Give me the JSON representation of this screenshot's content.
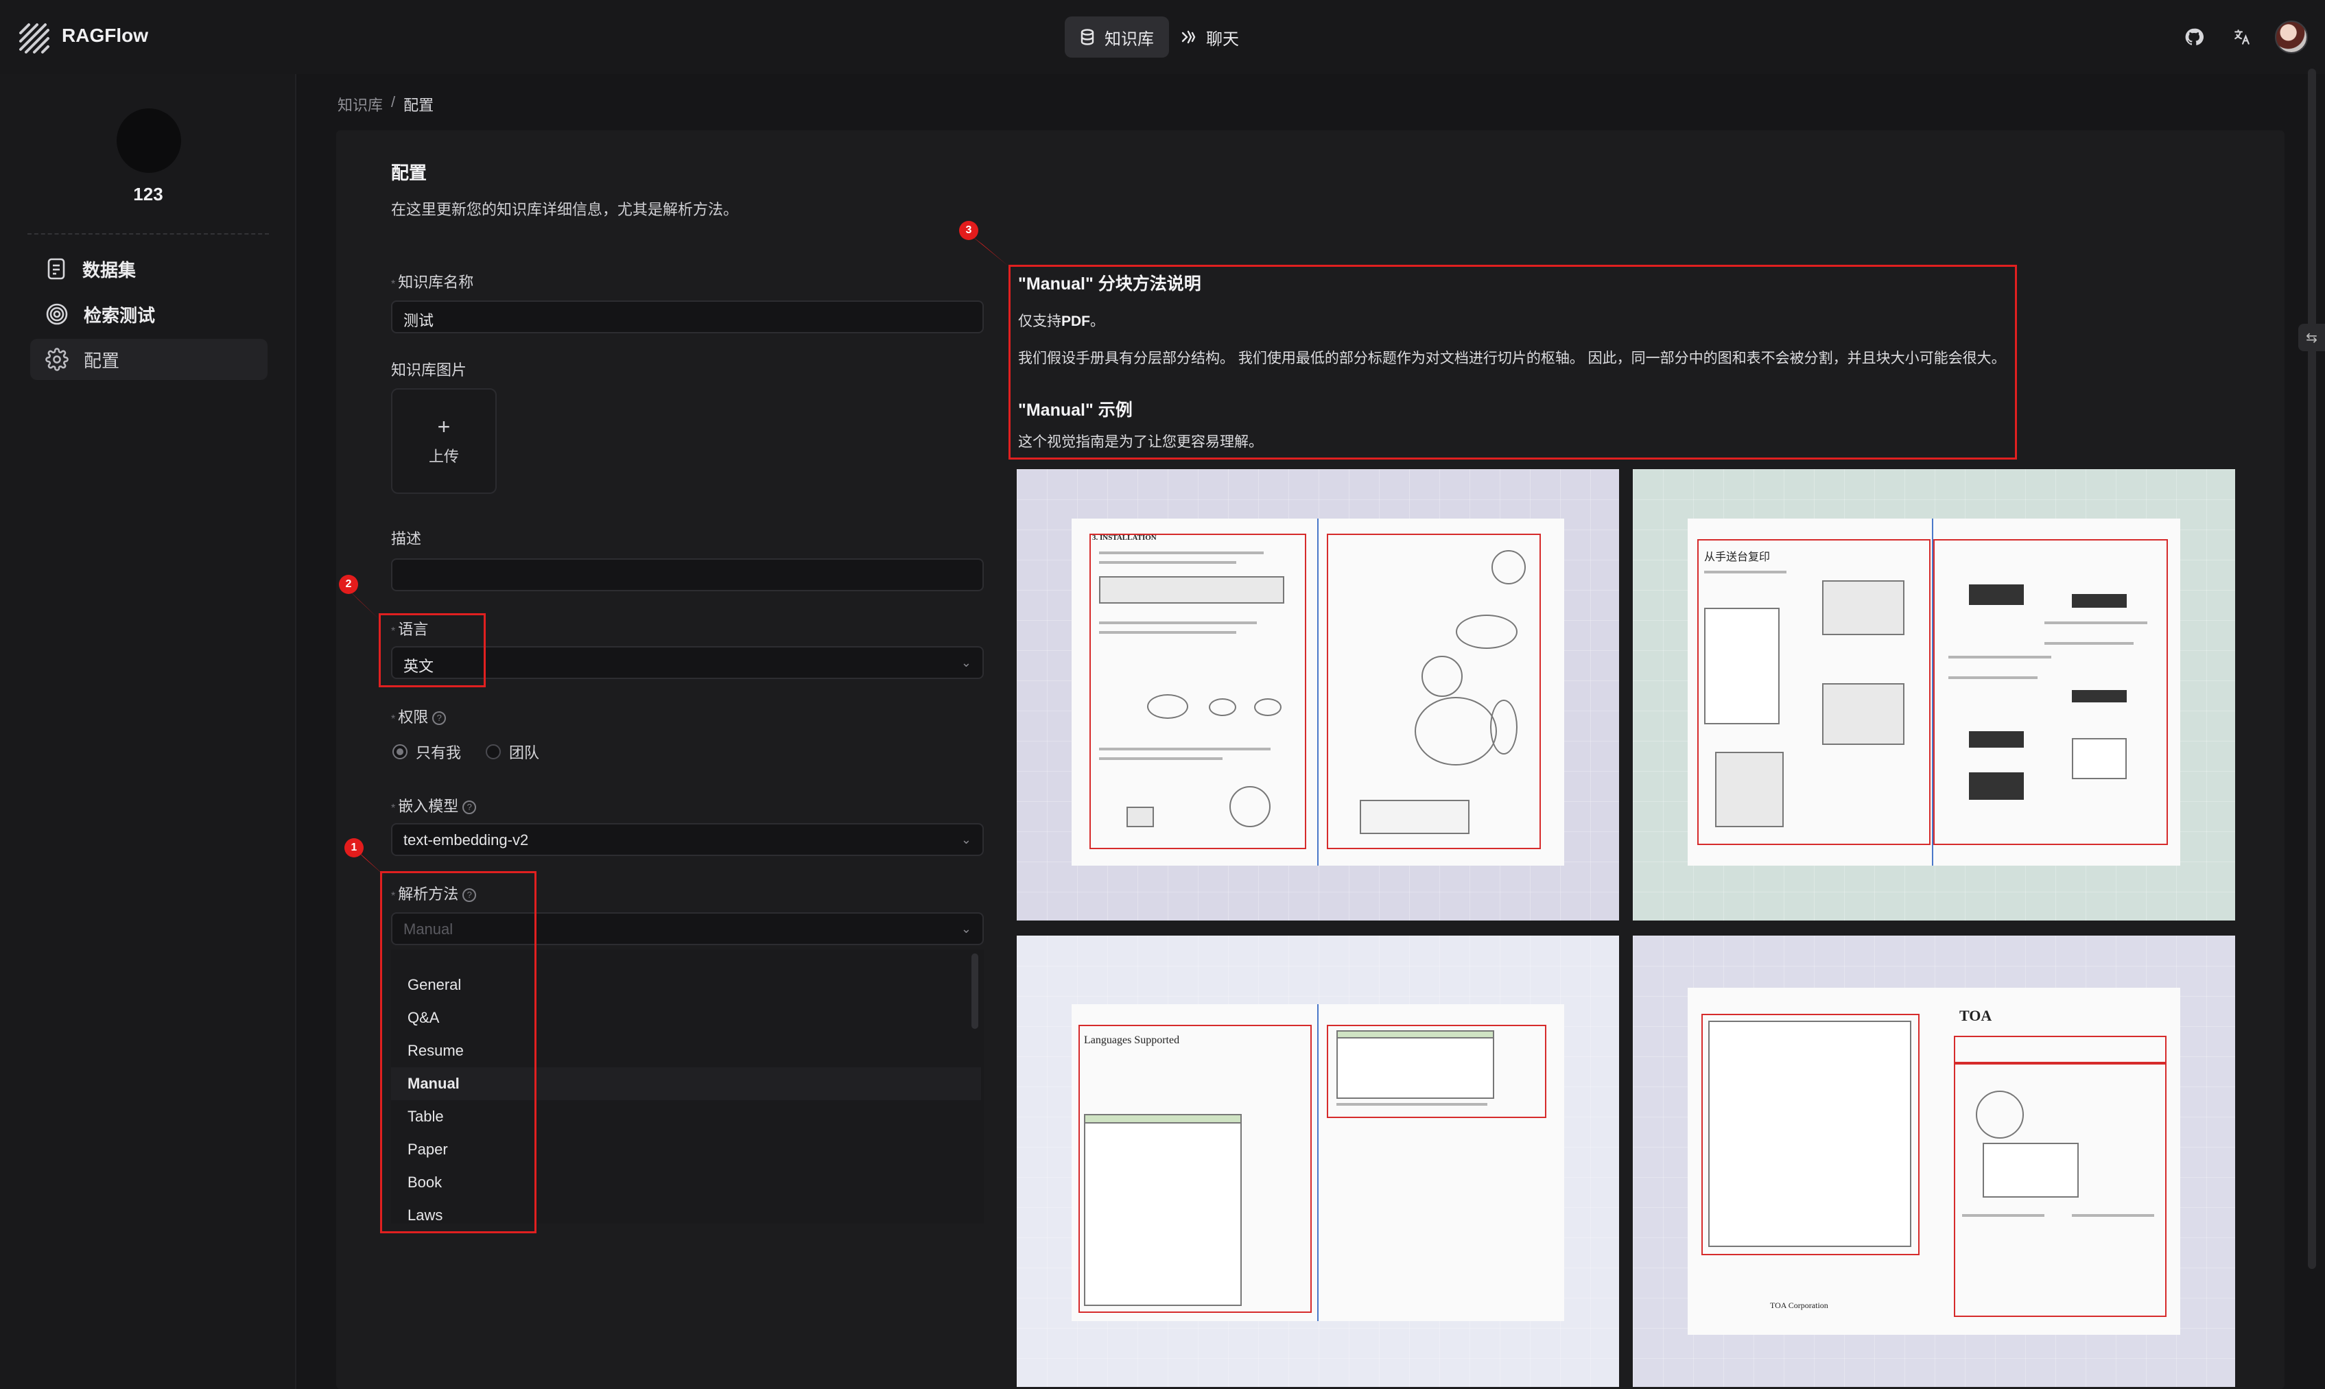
{
  "app": {
    "brand": "RAGFlow"
  },
  "topnav": [
    {
      "label": "知识库",
      "icon": "database-icon"
    },
    {
      "label": "聊天",
      "icon": "chat-icon"
    }
  ],
  "sidebar": {
    "kb_name": "123",
    "items": [
      {
        "label": "数据集",
        "icon": "document-icon"
      },
      {
        "label": "检索测试",
        "icon": "target-icon"
      },
      {
        "label": "配置",
        "icon": "gear-icon"
      }
    ]
  },
  "breadcrumb": {
    "root": "知识库",
    "separator": "/",
    "current": "配置"
  },
  "config": {
    "title": "配置",
    "subtitle": "在这里更新您的知识库详细信息，尤其是解析方法。",
    "name_label": "知识库名称",
    "name_value": "测试",
    "image_label": "知识库图片",
    "upload_label": "上传",
    "upload_plus": "+",
    "desc_label": "描述",
    "desc_value": "",
    "language_label": "语言",
    "language_value": "英文",
    "permission_label": "权限",
    "permission_options": [
      "只有我",
      "团队"
    ],
    "permission_selected": "只有我",
    "embedding_label": "嵌入模型",
    "embedding_value": "text-embedding-v2",
    "parser_label": "解析方法",
    "parser_placeholder": "Manual",
    "parser_options": [
      "General",
      "Q&A",
      "Resume",
      "Manual",
      "Table",
      "Paper",
      "Book",
      "Laws"
    ],
    "parser_selected": "Manual"
  },
  "annotations": [
    "1",
    "2",
    "3"
  ],
  "annotation_color": "#e02020",
  "method_info": {
    "heading": "\"Manual\" 分块方法说明",
    "support_prefix": "仅支持",
    "support_format": "PDF",
    "support_suffix": "。",
    "body": "我们假设手册具有分层部分结构。 我们使用最低的部分标题作为对文档进行切片的枢轴。 因此，同一部分中的图和表不会被分割，并且块大小可能会很大。",
    "example_heading": "\"Manual\" 示例",
    "example_body": "这个视觉指南是为了让您更容易理解。"
  },
  "examples": {
    "installation": {
      "section": "3. INSTALLATION"
    },
    "languages": {
      "title": "Languages Supported"
    },
    "toa": {
      "brand": "TOA",
      "footer": "TOA Corporation"
    },
    "chinese": {
      "title": "从手送台复印"
    }
  }
}
